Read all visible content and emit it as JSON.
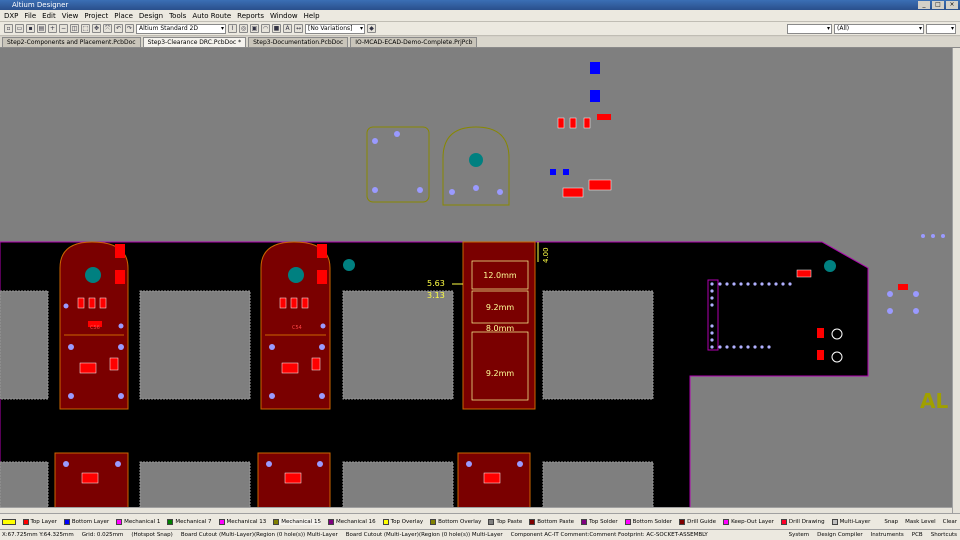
{
  "window": {
    "title": "Altium Designer"
  },
  "menu": [
    "DXP",
    "File",
    "Edit",
    "View",
    "Project",
    "Place",
    "Design",
    "Tools",
    "Auto Route",
    "Reports",
    "Window",
    "Help"
  ],
  "toolbar": {
    "view_mode": "Altium Standard 2D",
    "variations": "[No Variations]",
    "filter": "(All)"
  },
  "tabs": [
    {
      "label": "Step2-Components and Placement.PcbDoc",
      "active": false
    },
    {
      "label": "Step3-Clearance DRC.PcbDoc *",
      "active": true
    },
    {
      "label": "Step3-Documentation.PcbDoc",
      "active": false
    },
    {
      "label": "IO-MCAD-ECAD-Demo-Complete.PrjPcb",
      "active": false
    }
  ],
  "canvas": {
    "dims": {
      "d1": "12.0mm",
      "d2": "9.2mm",
      "d3": "8.0mm",
      "d4": "9.2mm",
      "left1": "5.63",
      "left2": "3.13",
      "vert": "4.00"
    },
    "labels": {
      "c56": "C56",
      "c54": "C54",
      "al": "AL"
    }
  },
  "layers": [
    {
      "name": "Top Layer",
      "color": "#ff0000"
    },
    {
      "name": "Bottom Layer",
      "color": "#0000ff"
    },
    {
      "name": "Mechanical 1",
      "color": "#ff00ff"
    },
    {
      "name": "Mechanical 7",
      "color": "#008000"
    },
    {
      "name": "Mechanical 13",
      "color": "#ff00ff"
    },
    {
      "name": "Mechanical 15",
      "color": "#808000"
    },
    {
      "name": "Mechanical 16",
      "color": "#800080"
    },
    {
      "name": "Top Overlay",
      "color": "#ffff00"
    },
    {
      "name": "Bottom Overlay",
      "color": "#808000"
    },
    {
      "name": "Top Paste",
      "color": "#808080"
    },
    {
      "name": "Bottom Paste",
      "color": "#800000"
    },
    {
      "name": "Top Solder",
      "color": "#800080"
    },
    {
      "name": "Bottom Solder",
      "color": "#ff00ff"
    },
    {
      "name": "Drill Guide",
      "color": "#800000"
    },
    {
      "name": "Keep-Out Layer",
      "color": "#ff00ff"
    },
    {
      "name": "Drill Drawing",
      "color": "#ff002a"
    },
    {
      "name": "Multi-Layer",
      "color": "#c0c0c0"
    }
  ],
  "layer_controls": {
    "snap": "Snap",
    "mask": "Mask Level",
    "clear": "Clear"
  },
  "status": {
    "coords": "X:67.725mm Y:64.325mm",
    "grid": "Grid: 0.025mm",
    "hotspot": "(Hotspot Snap)",
    "cutout1": "Board Cutout (Multi-Layer)(Region (0 hole(s)) Multi-Layer",
    "cutout2": "Board Cutout (Multi-Layer)(Region (0 hole(s)) Multi-Layer",
    "component": "Component AC-IT Comment:Comment Footprint: AC-SOCKET-ASSEMBLY",
    "panels": [
      "System",
      "Design Compiler",
      "Instruments",
      "PCB",
      "Shortcuts"
    ]
  }
}
